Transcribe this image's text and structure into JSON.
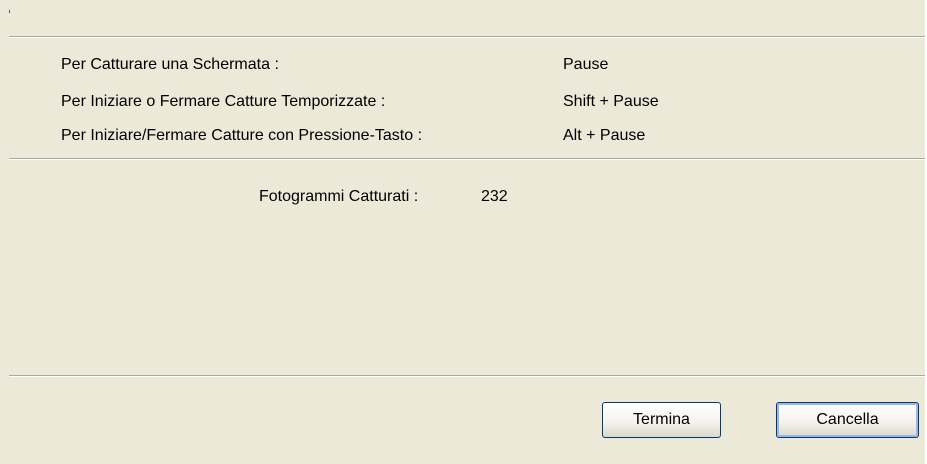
{
  "shortcuts": [
    {
      "label": "Per Catturare una Schermata :",
      "key": "Pause"
    },
    {
      "label": "Per Iniziare o Fermare Catture Temporizzate :",
      "key": "Shift + Pause"
    },
    {
      "label": "Per Iniziare/Fermare Catture con Pressione-Tasto :",
      "key": "Alt + Pause"
    }
  ],
  "frames": {
    "label": "Fotogrammi Catturati :",
    "value": "232"
  },
  "buttons": {
    "finish_label": "Termina",
    "cancel_label": "Cancella"
  }
}
